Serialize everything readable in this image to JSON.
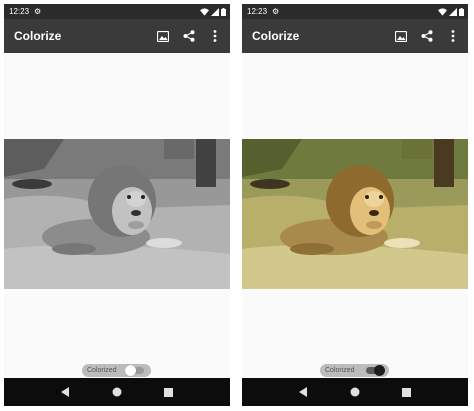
{
  "screens": [
    {
      "status": {
        "time": "12:23"
      },
      "app_bar": {
        "title": "Colorize",
        "actions": [
          "image-icon",
          "share-icon",
          "more-vert-icon"
        ]
      },
      "photo": {
        "subject": "lion-icon",
        "style": "grayscale"
      },
      "toggle": {
        "label": "Colorized",
        "on": false
      },
      "nav": [
        "back-icon",
        "home-icon",
        "recents-icon"
      ]
    },
    {
      "status": {
        "time": "12:23"
      },
      "app_bar": {
        "title": "Colorize",
        "actions": [
          "image-icon",
          "share-icon",
          "more-vert-icon"
        ]
      },
      "photo": {
        "subject": "lion-icon",
        "style": "colorized"
      },
      "toggle": {
        "label": "Colorized",
        "on": true
      },
      "nav": [
        "back-icon",
        "home-icon",
        "recents-icon"
      ]
    }
  ],
  "colors": {
    "status_bar": "#2b2b2b",
    "app_bar": "#3a3a3a",
    "nav_bar": "#0c0c0c",
    "content_bg": "#fafafa"
  }
}
